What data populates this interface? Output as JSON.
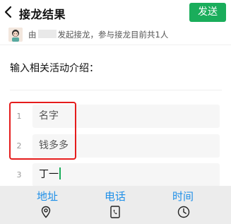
{
  "header": {
    "title": "接龙结果",
    "send_label": "发送"
  },
  "info": {
    "prefix": "由",
    "suffix": "发起接龙，参与接龙目前共1人"
  },
  "prompt": "输入相关活动介绍：",
  "items": [
    {
      "num": "1",
      "text": "名字"
    },
    {
      "num": "2",
      "text": "钱多多"
    },
    {
      "num": "3",
      "text": "丁一"
    }
  ],
  "toolbar": {
    "address_label": "地址",
    "phone_label": "电话",
    "time_label": "时间"
  },
  "colors": {
    "accent_green": "#1aad5b",
    "highlight_red": "#e51c1c",
    "toolbar_blue": "#1e8fe8"
  }
}
